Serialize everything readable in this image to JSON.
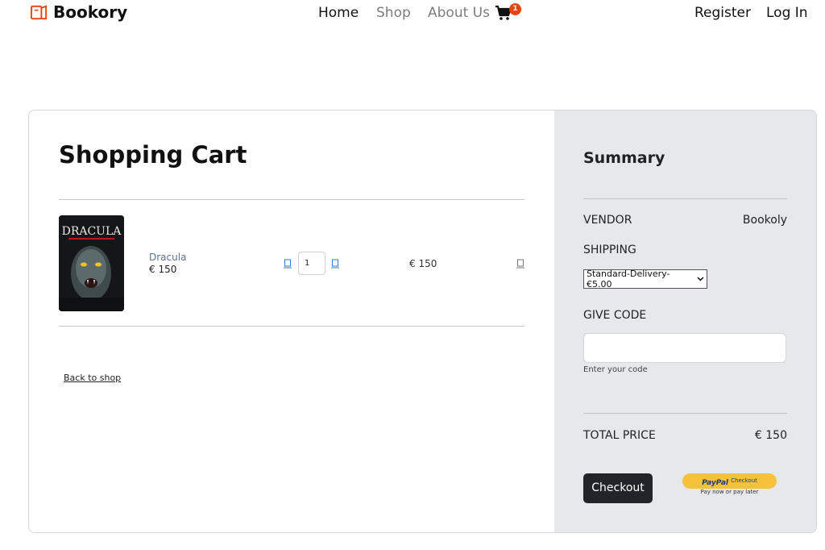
{
  "nav": {
    "brand": "Bookory",
    "links": [
      "Home",
      "Shop",
      "About Us"
    ],
    "cart_count": "1",
    "register": "Register",
    "login": "Log In",
    "icons": {
      "logo": "book-logo-icon",
      "cart": "shopping-cart-icon"
    }
  },
  "cart": {
    "title": "Shopping Cart",
    "items": [
      {
        "name": "Dracula",
        "price": "€ 150",
        "quantity": "1",
        "line_total": "€ 150",
        "cover_title": "DRACULA"
      }
    ],
    "back_link": "Back to shop"
  },
  "summary": {
    "title": "Summary",
    "vendor_label": "VENDOR",
    "vendor_value": "Bookoly",
    "shipping_label": "SHIPPING",
    "shipping_selected": "Standard-Delivery- €5.00",
    "give_code_label": "GIVE CODE",
    "code_help": "Enter your code",
    "total_label": "TOTAL PRICE",
    "total_value": "€ 150",
    "checkout_label": "Checkout",
    "paypal_label": "PayPal",
    "paypal_suffix": "Checkout",
    "paypal_tagline": "Pay now or pay later"
  },
  "colors": {
    "accent": "#e8440c",
    "summary_bg": "#e6e8eb",
    "checkout_bg": "#212529",
    "paypal_yellow": "#f7c13a",
    "link_muted": "#7d7d7d"
  }
}
